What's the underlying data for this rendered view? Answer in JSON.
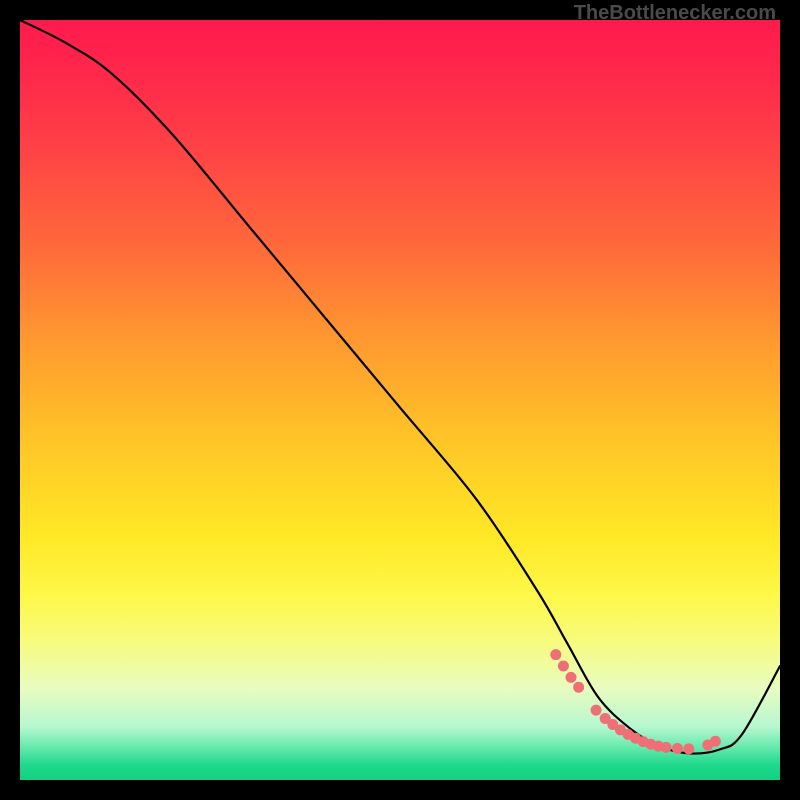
{
  "watermark": "TheBottlenecker.com",
  "chart_data": {
    "type": "line",
    "title": "",
    "xlabel": "",
    "ylabel": "",
    "xlim": [
      0,
      100
    ],
    "ylim": [
      0,
      100
    ],
    "series": [
      {
        "name": "curve",
        "x": [
          0,
          6,
          12,
          20,
          30,
          40,
          50,
          60,
          68,
          72,
          76,
          80,
          84,
          88,
          92,
          95,
          100
        ],
        "y": [
          100,
          97,
          93,
          85,
          73,
          61,
          49,
          37,
          25,
          18,
          11,
          7,
          4.5,
          3.5,
          4,
          6,
          15
        ]
      }
    ],
    "markers": {
      "name": "highlight-dots",
      "color": "#ef6f77",
      "x": [
        70.5,
        71.5,
        72.5,
        73.5,
        75.8,
        77,
        78,
        79,
        80,
        81,
        82,
        83,
        84,
        85,
        86.5,
        88,
        90.5,
        91.5
      ],
      "y": [
        16.5,
        15,
        13.5,
        12.2,
        9.2,
        8.1,
        7.3,
        6.6,
        6,
        5.5,
        5.05,
        4.7,
        4.45,
        4.3,
        4.15,
        4.1,
        4.6,
        5.1
      ]
    }
  }
}
